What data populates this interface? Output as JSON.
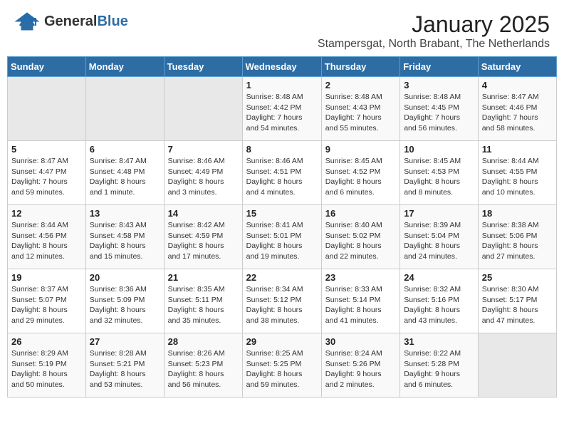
{
  "header": {
    "logo_general": "General",
    "logo_blue": "Blue",
    "month_year": "January 2025",
    "location": "Stampersgat, North Brabant, The Netherlands"
  },
  "days_of_week": [
    "Sunday",
    "Monday",
    "Tuesday",
    "Wednesday",
    "Thursday",
    "Friday",
    "Saturday"
  ],
  "weeks": [
    [
      {
        "day": "",
        "content": ""
      },
      {
        "day": "",
        "content": ""
      },
      {
        "day": "",
        "content": ""
      },
      {
        "day": "1",
        "content": "Sunrise: 8:48 AM\nSunset: 4:42 PM\nDaylight: 7 hours\nand 54 minutes."
      },
      {
        "day": "2",
        "content": "Sunrise: 8:48 AM\nSunset: 4:43 PM\nDaylight: 7 hours\nand 55 minutes."
      },
      {
        "day": "3",
        "content": "Sunrise: 8:48 AM\nSunset: 4:45 PM\nDaylight: 7 hours\nand 56 minutes."
      },
      {
        "day": "4",
        "content": "Sunrise: 8:47 AM\nSunset: 4:46 PM\nDaylight: 7 hours\nand 58 minutes."
      }
    ],
    [
      {
        "day": "5",
        "content": "Sunrise: 8:47 AM\nSunset: 4:47 PM\nDaylight: 7 hours\nand 59 minutes."
      },
      {
        "day": "6",
        "content": "Sunrise: 8:47 AM\nSunset: 4:48 PM\nDaylight: 8 hours\nand 1 minute."
      },
      {
        "day": "7",
        "content": "Sunrise: 8:46 AM\nSunset: 4:49 PM\nDaylight: 8 hours\nand 3 minutes."
      },
      {
        "day": "8",
        "content": "Sunrise: 8:46 AM\nSunset: 4:51 PM\nDaylight: 8 hours\nand 4 minutes."
      },
      {
        "day": "9",
        "content": "Sunrise: 8:45 AM\nSunset: 4:52 PM\nDaylight: 8 hours\nand 6 minutes."
      },
      {
        "day": "10",
        "content": "Sunrise: 8:45 AM\nSunset: 4:53 PM\nDaylight: 8 hours\nand 8 minutes."
      },
      {
        "day": "11",
        "content": "Sunrise: 8:44 AM\nSunset: 4:55 PM\nDaylight: 8 hours\nand 10 minutes."
      }
    ],
    [
      {
        "day": "12",
        "content": "Sunrise: 8:44 AM\nSunset: 4:56 PM\nDaylight: 8 hours\nand 12 minutes."
      },
      {
        "day": "13",
        "content": "Sunrise: 8:43 AM\nSunset: 4:58 PM\nDaylight: 8 hours\nand 15 minutes."
      },
      {
        "day": "14",
        "content": "Sunrise: 8:42 AM\nSunset: 4:59 PM\nDaylight: 8 hours\nand 17 minutes."
      },
      {
        "day": "15",
        "content": "Sunrise: 8:41 AM\nSunset: 5:01 PM\nDaylight: 8 hours\nand 19 minutes."
      },
      {
        "day": "16",
        "content": "Sunrise: 8:40 AM\nSunset: 5:02 PM\nDaylight: 8 hours\nand 22 minutes."
      },
      {
        "day": "17",
        "content": "Sunrise: 8:39 AM\nSunset: 5:04 PM\nDaylight: 8 hours\nand 24 minutes."
      },
      {
        "day": "18",
        "content": "Sunrise: 8:38 AM\nSunset: 5:06 PM\nDaylight: 8 hours\nand 27 minutes."
      }
    ],
    [
      {
        "day": "19",
        "content": "Sunrise: 8:37 AM\nSunset: 5:07 PM\nDaylight: 8 hours\nand 29 minutes."
      },
      {
        "day": "20",
        "content": "Sunrise: 8:36 AM\nSunset: 5:09 PM\nDaylight: 8 hours\nand 32 minutes."
      },
      {
        "day": "21",
        "content": "Sunrise: 8:35 AM\nSunset: 5:11 PM\nDaylight: 8 hours\nand 35 minutes."
      },
      {
        "day": "22",
        "content": "Sunrise: 8:34 AM\nSunset: 5:12 PM\nDaylight: 8 hours\nand 38 minutes."
      },
      {
        "day": "23",
        "content": "Sunrise: 8:33 AM\nSunset: 5:14 PM\nDaylight: 8 hours\nand 41 minutes."
      },
      {
        "day": "24",
        "content": "Sunrise: 8:32 AM\nSunset: 5:16 PM\nDaylight: 8 hours\nand 43 minutes."
      },
      {
        "day": "25",
        "content": "Sunrise: 8:30 AM\nSunset: 5:17 PM\nDaylight: 8 hours\nand 47 minutes."
      }
    ],
    [
      {
        "day": "26",
        "content": "Sunrise: 8:29 AM\nSunset: 5:19 PM\nDaylight: 8 hours\nand 50 minutes."
      },
      {
        "day": "27",
        "content": "Sunrise: 8:28 AM\nSunset: 5:21 PM\nDaylight: 8 hours\nand 53 minutes."
      },
      {
        "day": "28",
        "content": "Sunrise: 8:26 AM\nSunset: 5:23 PM\nDaylight: 8 hours\nand 56 minutes."
      },
      {
        "day": "29",
        "content": "Sunrise: 8:25 AM\nSunset: 5:25 PM\nDaylight: 8 hours\nand 59 minutes."
      },
      {
        "day": "30",
        "content": "Sunrise: 8:24 AM\nSunset: 5:26 PM\nDaylight: 9 hours\nand 2 minutes."
      },
      {
        "day": "31",
        "content": "Sunrise: 8:22 AM\nSunset: 5:28 PM\nDaylight: 9 hours\nand 6 minutes."
      },
      {
        "day": "",
        "content": ""
      }
    ]
  ]
}
